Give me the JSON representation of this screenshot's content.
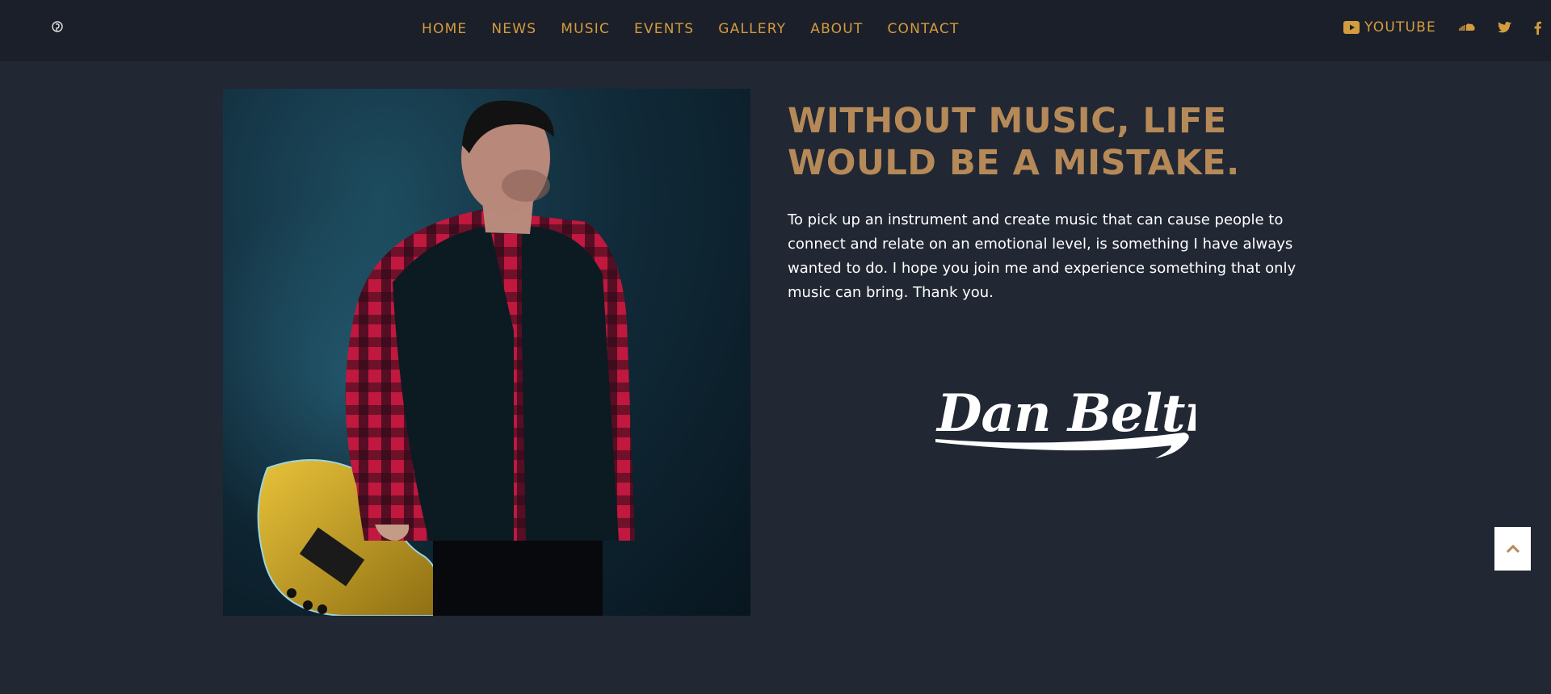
{
  "nav": {
    "items": [
      {
        "label": "HOME"
      },
      {
        "label": "NEWS"
      },
      {
        "label": "MUSIC"
      },
      {
        "label": "EVENTS"
      },
      {
        "label": "GALLERY"
      },
      {
        "label": "ABOUT"
      },
      {
        "label": "CONTACT"
      }
    ]
  },
  "social": {
    "youtube_label": "YOUTUBE",
    "icons": [
      "youtube-icon",
      "soundcloud-icon",
      "twitter-icon",
      "facebook-icon"
    ]
  },
  "about": {
    "headline": "WITHOUT MUSIC, LIFE WOULD BE A MISTAKE.",
    "body": "To pick up an instrument and create music that can cause people to connect and relate on an emotional level, is something I have always wanted to do. I hope you join me and experience something that only music can bring. Thank you.",
    "signature": "Dan Beltran"
  },
  "colors": {
    "background": "#212733",
    "header": "#1b1f29",
    "accent": "#d39c3f",
    "headline": "#b58958",
    "text": "#ffffff"
  }
}
